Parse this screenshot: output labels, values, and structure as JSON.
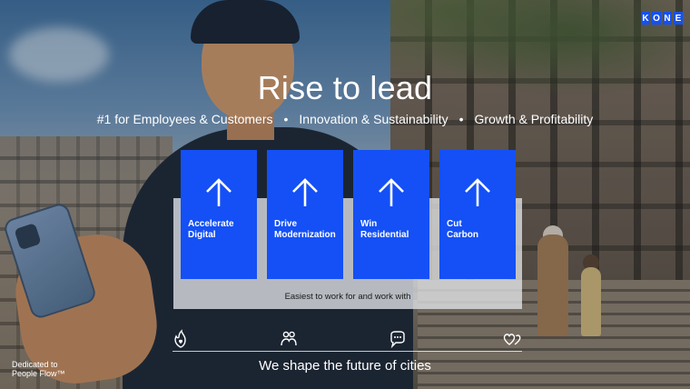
{
  "brand": {
    "logo_letters": [
      "K",
      "O",
      "N",
      "E"
    ],
    "color": "#1450f5"
  },
  "headline": "Rise to lead",
  "tagline": {
    "items": [
      "#1 for Employees & Customers",
      "Innovation & Sustainability",
      "Growth & Profitability"
    ],
    "separator": "•"
  },
  "pillars": [
    {
      "line1": "Accelerate",
      "line2": "Digital",
      "icon": "arrow-up-icon"
    },
    {
      "line1": "Drive",
      "line2": "Modernization",
      "icon": "arrow-up-icon"
    },
    {
      "line1": "Win",
      "line2": "Residential",
      "icon": "arrow-up-icon"
    },
    {
      "line1": "Cut",
      "line2": "Carbon",
      "icon": "arrow-up-icon"
    }
  ],
  "panel_label": "Easiest to work for and work with",
  "value_icons": [
    "flame-heart-icon",
    "people-icon",
    "chat-bubble-icon",
    "hearts-icon"
  ],
  "footer": "We shape the future of cities",
  "dedicated": {
    "line1": "Dedicated to",
    "line2": "People Flow™"
  }
}
